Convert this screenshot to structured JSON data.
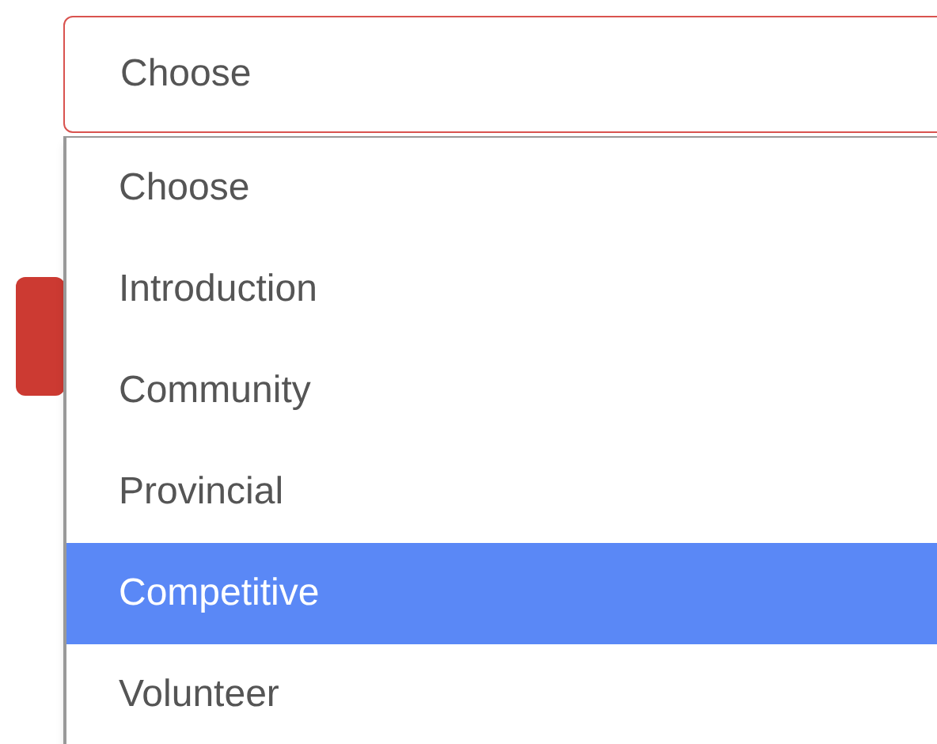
{
  "select": {
    "value": "Choose",
    "expanded": true,
    "options": [
      {
        "label": "Choose",
        "highlighted": false
      },
      {
        "label": "Introduction",
        "highlighted": false
      },
      {
        "label": "Community",
        "highlighted": false
      },
      {
        "label": "Provincial",
        "highlighted": false
      },
      {
        "label": "Competitive",
        "highlighted": true
      },
      {
        "label": "Volunteer",
        "highlighted": false
      }
    ]
  }
}
